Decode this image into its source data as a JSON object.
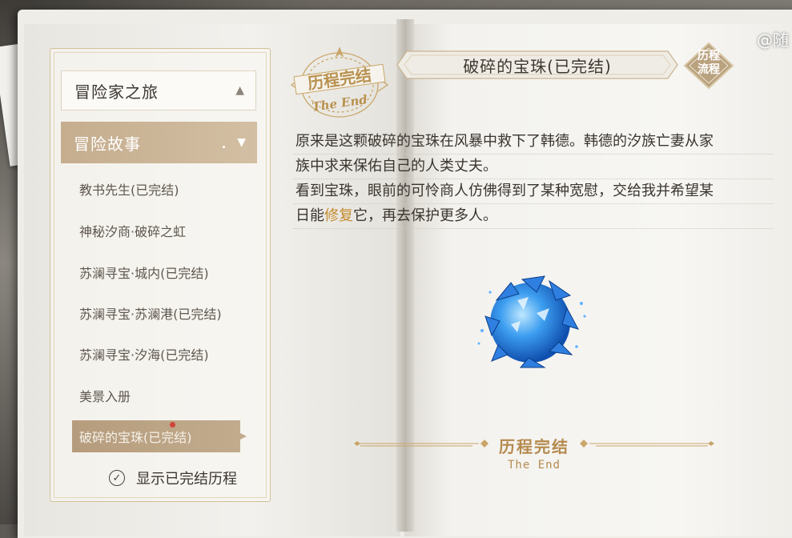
{
  "sidebar": {
    "section_title": "冒险家之旅",
    "category_title": "冒险故事",
    "items": [
      {
        "label": "教书先生(已完结)"
      },
      {
        "label": "神秘汐商·破碎之虹"
      },
      {
        "label": "苏澜寻宝·城内(已完结)"
      },
      {
        "label": "苏澜寻宝·苏澜港(已完结)"
      },
      {
        "label": "苏澜寻宝·汐海(已完结)"
      },
      {
        "label": "美景入册"
      },
      {
        "label": "破碎的宝珠(已完结)"
      }
    ],
    "selected_index": 6,
    "show_completed_label": "显示已完结历程",
    "show_completed_checked": true
  },
  "stamp": {
    "line1": "历程完结",
    "line2": "The End"
  },
  "header": {
    "title": "破碎的宝珠(已完结)",
    "flow_badge_line1": "历程",
    "flow_badge_line2": "流程"
  },
  "watermark": "@随",
  "story": {
    "line1": "原来是这颗破碎的宝珠在风暴中救下了韩德。韩德的汐族亡妻从家",
    "line2": "族中求来保佑自己的人类丈夫。",
    "line3": "看到宝珠，眼前的可怜商人仿佛得到了某种宽慰，交给我并希望某",
    "line4_before": "日能",
    "line4_highlight": "修复",
    "line4_after": "它，再去保护更多人。"
  },
  "end_banner": {
    "title": "历程完结",
    "subtitle": "The End"
  },
  "colors": {
    "accent_gold": "#b58a4e",
    "highlight": "#c48a2c",
    "selected_bg": "#b59c7d"
  }
}
